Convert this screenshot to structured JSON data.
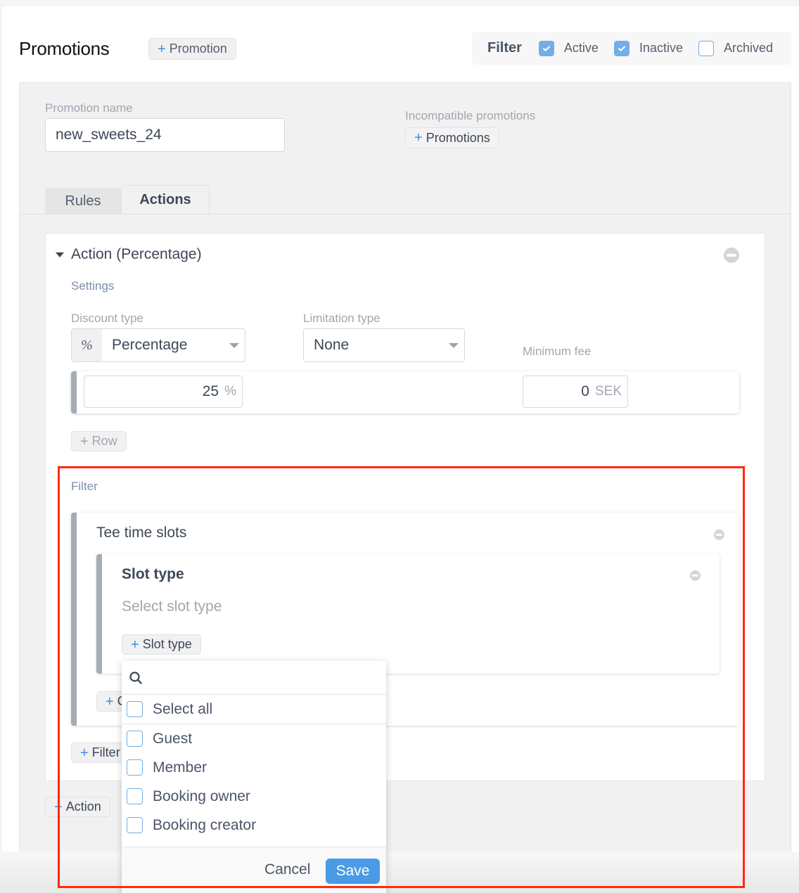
{
  "header": {
    "title": "Promotions",
    "add_promotion_label": "Promotion",
    "filter": {
      "label": "Filter",
      "options": [
        {
          "label": "Active",
          "checked": true
        },
        {
          "label": "Inactive",
          "checked": true
        },
        {
          "label": "Archived",
          "checked": false
        }
      ]
    }
  },
  "form": {
    "promotion_name_label": "Promotion name",
    "promotion_name_value": "new_sweets_24",
    "incompatible_label": "Incompatible promotions",
    "add_promotions_label": "Promotions",
    "tabs": [
      {
        "label": "Rules",
        "active": false
      },
      {
        "label": "Actions",
        "active": true
      }
    ]
  },
  "action": {
    "title": "Action (Percentage)",
    "settings_label": "Settings",
    "discount_type_label": "Discount type",
    "discount_type_prefix": "%",
    "discount_type_value": "Percentage",
    "limitation_type_label": "Limitation type",
    "limitation_type_value": "None",
    "minimum_fee_label": "Minimum fee",
    "percent_value": "25",
    "percent_unit": "%",
    "min_fee_value": "0",
    "min_fee_unit": "SEK",
    "add_row_label": "Row",
    "filter_label": "Filter",
    "tee_time_title": "Tee time slots",
    "slot_type_title": "Slot type",
    "slot_type_placeholder": "Select slot type",
    "add_slot_type_label": "Slot type",
    "add_condition_label": "C",
    "add_filter_label": "Filter"
  },
  "add_action_label": "Action",
  "dropdown": {
    "search_placeholder": "",
    "select_all_label": "Select all",
    "items": [
      {
        "label": "Guest",
        "checked": false
      },
      {
        "label": "Member",
        "checked": false
      },
      {
        "label": "Booking owner",
        "checked": false
      },
      {
        "label": "Booking creator",
        "checked": false
      }
    ],
    "cancel_label": "Cancel",
    "save_label": "Save"
  },
  "colors": {
    "accent": "#4a9be6",
    "checkbox": "#74aee6",
    "highlight_box": "#ff2a0f"
  }
}
